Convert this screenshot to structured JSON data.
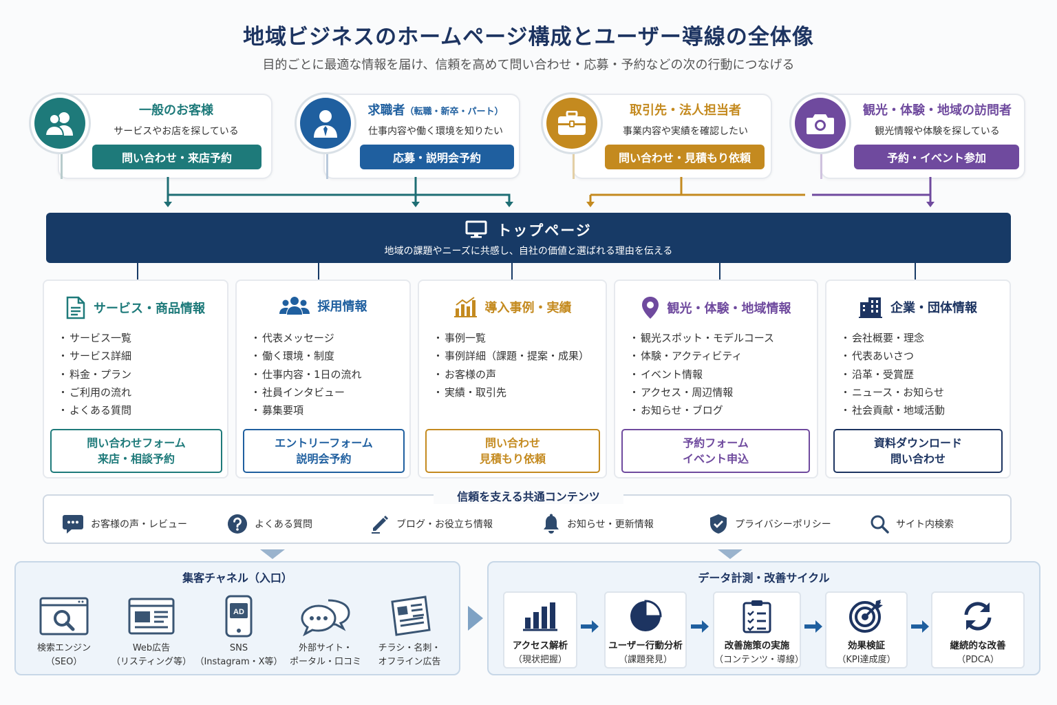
{
  "header": {
    "title": "地域ビジネスのホームページ構成とユーザー導線の全体像",
    "subtitle": "目的ごとに最適な情報を届け、信頼を高めて問い合わせ・応募・予約などの次の行動につなげる"
  },
  "personas": [
    {
      "title": "一般のお客様",
      "title_note": "",
      "desc": "サービスやお店を探している",
      "action": "問い合わせ・来店予約",
      "icon": "customers-icon",
      "color": "#1e7a7a"
    },
    {
      "title": "求職者",
      "title_note": "（転職・新卒・パート）",
      "desc": "仕事内容や働く環境を知りたい",
      "action": "応募・説明会予約",
      "icon": "job-seeker-icon",
      "color": "#1f5f9f"
    },
    {
      "title": "取引先・法人担当者",
      "title_note": "",
      "desc": "事業内容や実績を確認したい",
      "action": "問い合わせ・見積もり依頼",
      "icon": "briefcase-icon",
      "color": "#c48a1f"
    },
    {
      "title": "観光・体験・地域の訪問者",
      "title_note": "",
      "desc": "観光情報や体験を探している",
      "action": "予約・イベント参加",
      "icon": "camera-icon",
      "color": "#6f4a9e"
    }
  ],
  "top_page": {
    "title": "トップページ",
    "desc": "地域の課題やニーズに共感し、自社の価値と選ばれる理由を伝える",
    "icon": "monitor-icon"
  },
  "sections": [
    {
      "title": "サービス・商品情報",
      "icon": "document-icon",
      "color": "#1e7a7a",
      "items": [
        "サービス一覧",
        "サービス詳細",
        "料金・プラン",
        "ご利用の流れ",
        "よくある質問"
      ],
      "cta": [
        "問い合わせフォーム",
        "来店・相談予約"
      ]
    },
    {
      "title": "採用情報",
      "icon": "people-icon",
      "color": "#1f5f9f",
      "items": [
        "代表メッセージ",
        "働く環境・制度",
        "仕事内容・1日の流れ",
        "社員インタビュー",
        "募集要項"
      ],
      "cta": [
        "エントリーフォーム",
        "説明会予約"
      ]
    },
    {
      "title": "導入事例・実績",
      "icon": "bar-chart-icon",
      "color": "#c48a1f",
      "items": [
        "事例一覧",
        "事例詳細（課題・提案・成果）",
        "お客様の声",
        "実績・取引先"
      ],
      "cta": [
        "問い合わせ",
        "見積もり依頼"
      ]
    },
    {
      "title": "観光・体験・地域情報",
      "icon": "map-pin-icon",
      "color": "#6f4a9e",
      "items": [
        "観光スポット・モデルコース",
        "体験・アクティビティ",
        "イベント情報",
        "アクセス・周辺情報",
        "お知らせ・ブログ"
      ],
      "cta": [
        "予約フォーム",
        "イベント申込"
      ]
    },
    {
      "title": "企業・団体情報",
      "icon": "building-icon",
      "color": "#1d3461",
      "items": [
        "会社概要・理念",
        "代表あいさつ",
        "沿革・受賞歴",
        "ニュース・お知らせ",
        "社会貢献・地域活動"
      ],
      "cta": [
        "資料ダウンロード",
        "問い合わせ"
      ]
    }
  ],
  "common": {
    "title": "信頼を支える共通コンテンツ",
    "items": [
      {
        "label": "お客様の声・レビュー",
        "icon": "chat-bubble-icon"
      },
      {
        "label": "よくある質問",
        "icon": "question-icon"
      },
      {
        "label": "ブログ・お役立ち情報",
        "icon": "pencil-icon"
      },
      {
        "label": "お知らせ・更新情報",
        "icon": "bell-icon"
      },
      {
        "label": "プライバシーポリシー",
        "icon": "shield-check-icon"
      },
      {
        "label": "サイト内検索",
        "icon": "search-icon"
      }
    ]
  },
  "channels": {
    "title": "集客チャネル（入口）",
    "items": [
      {
        "label": [
          "検索エンジン",
          "（SEO）"
        ],
        "icon": "search-engine-icon"
      },
      {
        "label": [
          "Web広告",
          "（リスティング等）"
        ],
        "icon": "web-ad-icon"
      },
      {
        "label": [
          "SNS",
          "（Instagram・X等）"
        ],
        "icon": "smartphone-ad-icon",
        "badge": "AD"
      },
      {
        "label": [
          "外部サイト・",
          "ポータル・口コミ"
        ],
        "icon": "speech-bubbles-icon"
      },
      {
        "label": [
          "チラシ・名刺・",
          "オフライン広告"
        ],
        "icon": "flyer-icon"
      }
    ]
  },
  "cycle": {
    "title": "データ計測・改善サイクル",
    "items": [
      {
        "label": "アクセス解析",
        "sub": "（現状把握）",
        "icon": "analytics-bars-icon"
      },
      {
        "label": "ユーザー行動分析",
        "sub": "（課題発見）",
        "icon": "pie-chart-icon"
      },
      {
        "label": "改善施策の実施",
        "sub": "（コンテンツ・導線）",
        "icon": "checklist-icon"
      },
      {
        "label": "効果検証",
        "sub": "（KPI達成度）",
        "icon": "target-icon"
      },
      {
        "label": "継続的な改善",
        "sub": "（PDCA）",
        "icon": "refresh-icon"
      }
    ]
  }
}
